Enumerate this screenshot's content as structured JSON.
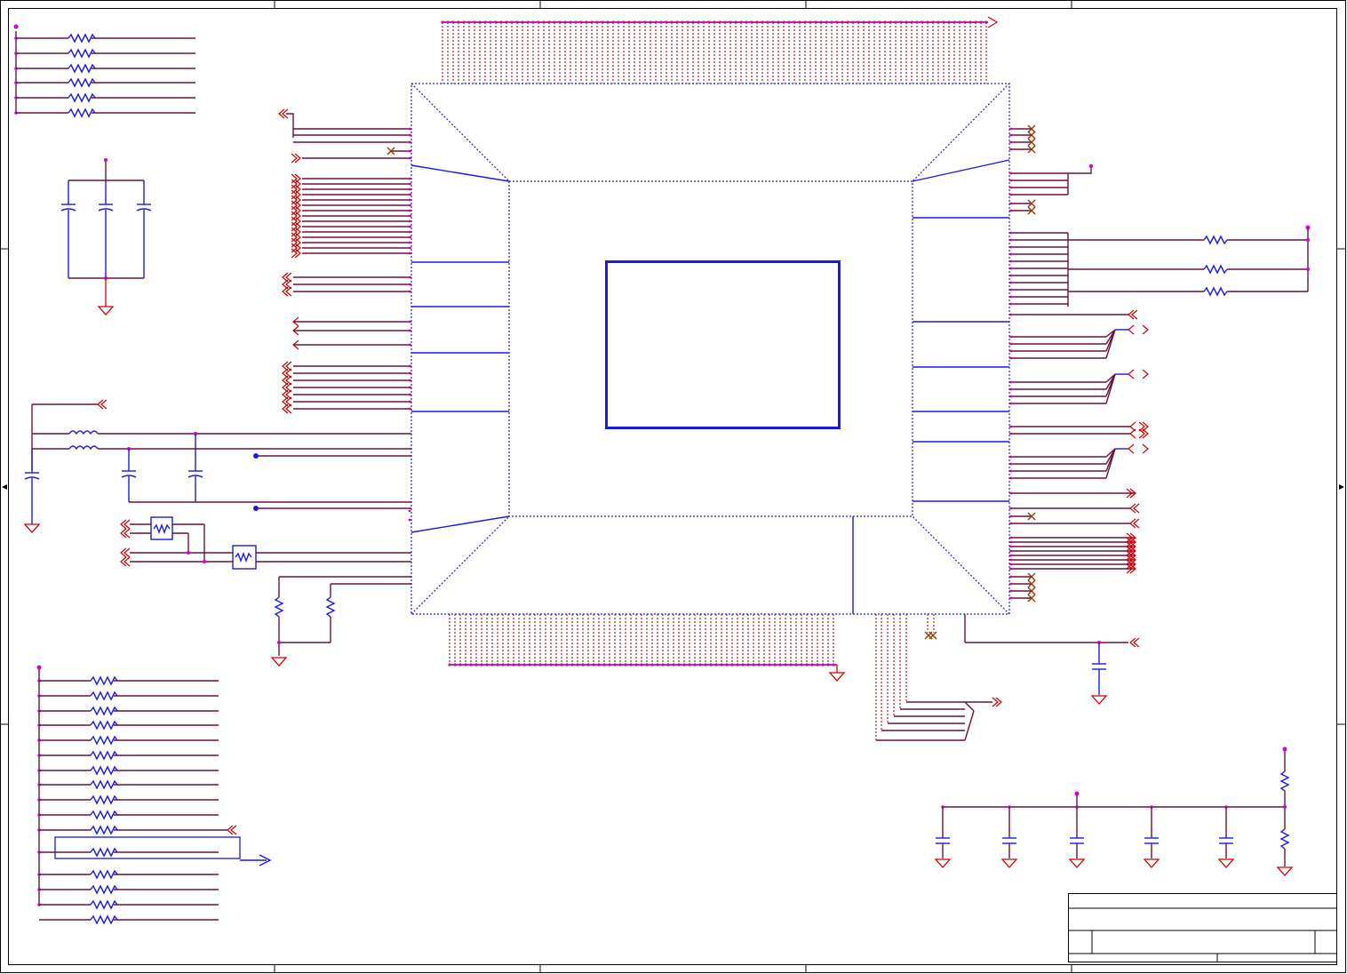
{
  "sheet": {
    "frame_color": "#000000",
    "net_color": "#6b1040",
    "pin_color": "#cc0000",
    "component_color": "#1a1ae6",
    "junction_color": "#d000d0"
  },
  "title_block": {
    "fields": []
  }
}
